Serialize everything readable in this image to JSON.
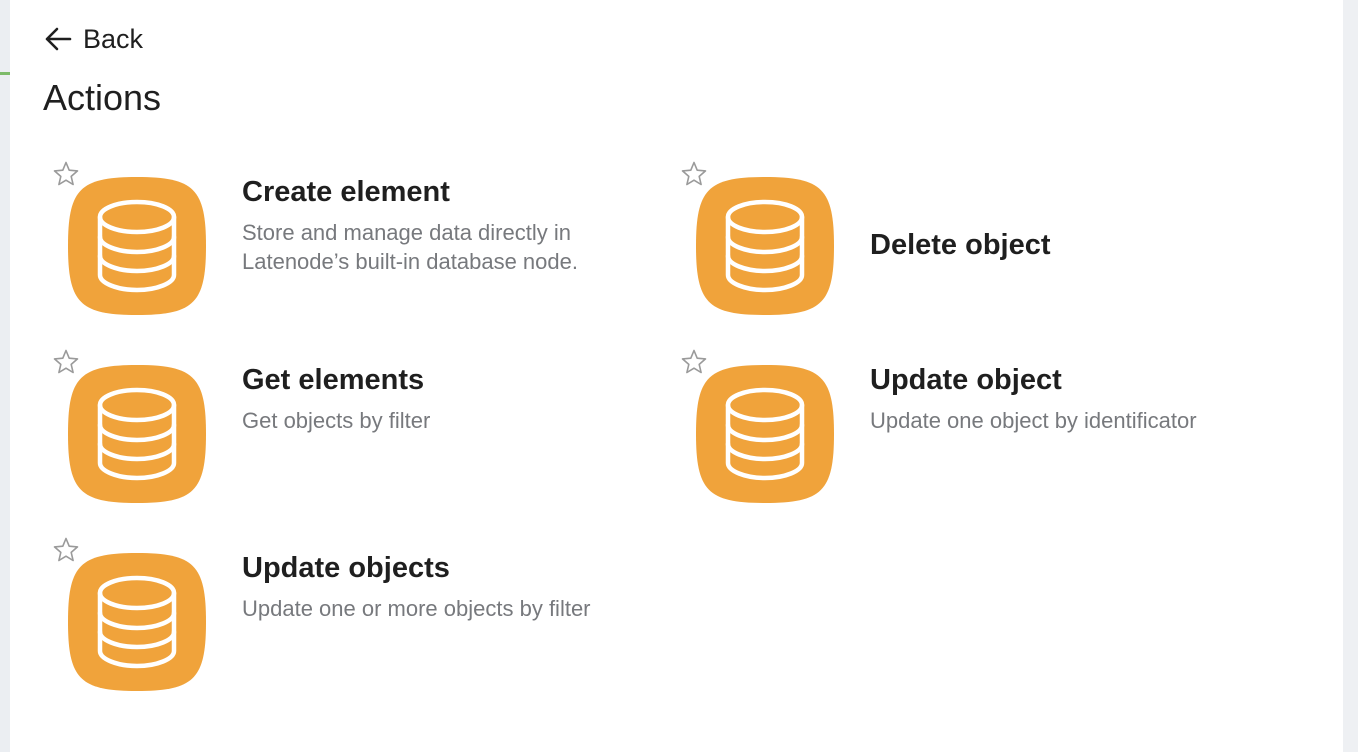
{
  "header": {
    "back_label": "Back",
    "title": "Actions"
  },
  "colors": {
    "icon_bg": "#f0a33b",
    "star_outline": "#9a9a9a"
  },
  "actions": [
    {
      "name": "Create element",
      "description": "Store and manage data directly in Latenode’s built-in database node.",
      "icon": "database-icon"
    },
    {
      "name": "Delete object",
      "description": "",
      "icon": "database-icon"
    },
    {
      "name": "Get elements",
      "description": "Get objects by filter",
      "icon": "database-icon"
    },
    {
      "name": "Update object",
      "description": "Update one object by identificator",
      "icon": "database-icon"
    },
    {
      "name": "Update objects",
      "description": "Update one or more objects by filter",
      "icon": "database-icon"
    }
  ]
}
